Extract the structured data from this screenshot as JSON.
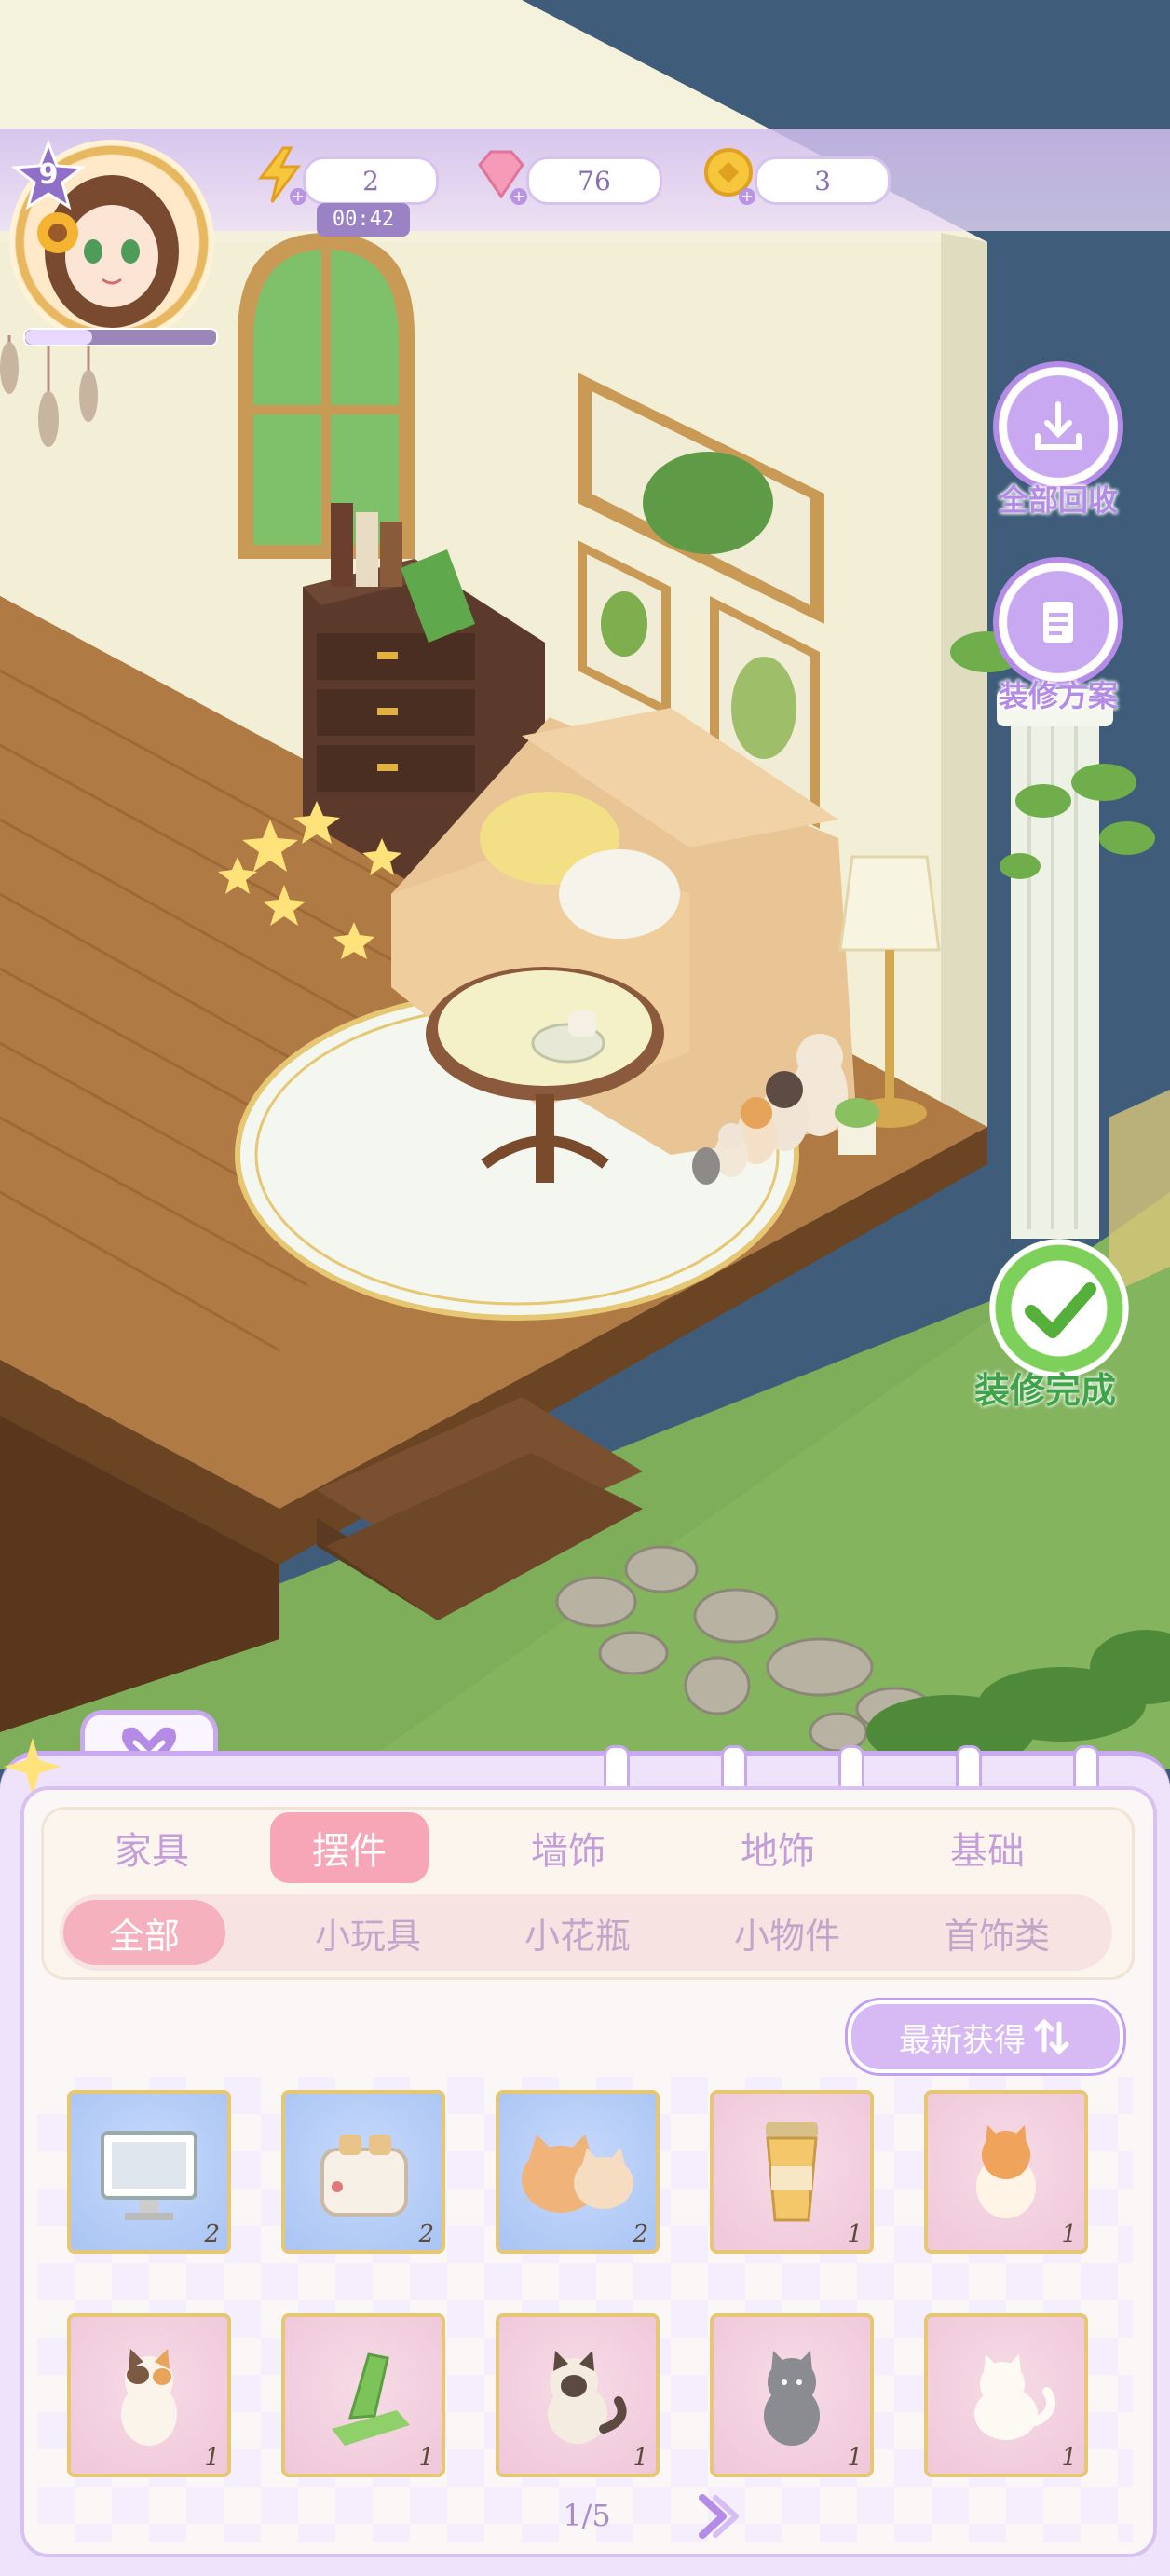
{
  "hud": {
    "level": "9",
    "xp_fraction": 0.35,
    "energy": {
      "icon": "lightning-icon",
      "value": "2",
      "timer": "00:42"
    },
    "gems": {
      "icon": "gem-icon",
      "value": "76"
    },
    "coins": {
      "icon": "coin-icon",
      "value": "3"
    }
  },
  "side_buttons": {
    "recycle_all": {
      "icon": "download-icon",
      "label": "全部回收"
    },
    "decor_plan": {
      "icon": "document-icon",
      "label": "装修方案"
    },
    "finish": {
      "icon": "check-icon",
      "label": "装修完成"
    }
  },
  "panel": {
    "main_tabs": [
      {
        "label": "家具",
        "active": false
      },
      {
        "label": "摆件",
        "active": true
      },
      {
        "label": "墙饰",
        "active": false
      },
      {
        "label": "地饰",
        "active": false
      },
      {
        "label": "基础",
        "active": false
      }
    ],
    "sub_tabs": [
      {
        "label": "全部",
        "active": true
      },
      {
        "label": "小玩具",
        "active": false
      },
      {
        "label": "小花瓶",
        "active": false
      },
      {
        "label": "小物件",
        "active": false
      },
      {
        "label": "首饰类",
        "active": false
      }
    ],
    "sort_label": "最新获得",
    "items": [
      {
        "icon": "monitor-icon",
        "bg": "blue",
        "count": "2"
      },
      {
        "icon": "toaster-icon",
        "bg": "blue",
        "count": "2"
      },
      {
        "icon": "cat-plush-icon",
        "bg": "blue",
        "count": "2"
      },
      {
        "icon": "cup-icon",
        "bg": "pink",
        "count": "1"
      },
      {
        "icon": "orange-cat-icon",
        "bg": "pink",
        "count": "1"
      },
      {
        "icon": "calico-cat-icon",
        "bg": "pink",
        "count": "1"
      },
      {
        "icon": "green-stand-icon",
        "bg": "pink",
        "count": "1"
      },
      {
        "icon": "siamese-cat-icon",
        "bg": "pink",
        "count": "1"
      },
      {
        "icon": "gray-cat-icon",
        "bg": "pink",
        "count": "1"
      },
      {
        "icon": "white-cat-icon",
        "bg": "pink",
        "count": "1"
      }
    ],
    "page": "1/5"
  },
  "colors": {
    "accent": "#c8a9ef",
    "active_tab": "#f6a6b7",
    "card_border": "#e6c774"
  }
}
